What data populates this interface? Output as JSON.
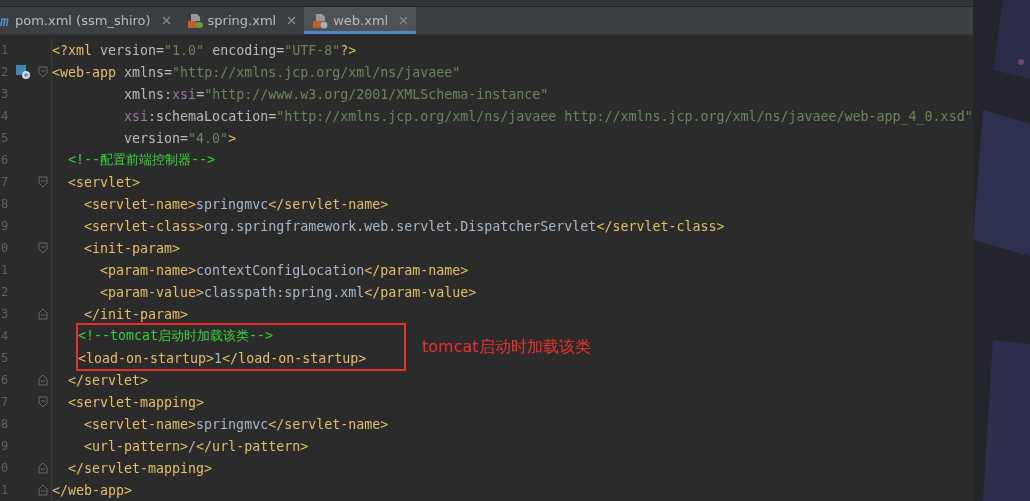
{
  "tabs": [
    {
      "label": "pom.xml (ssm_shiro)",
      "selected": false
    },
    {
      "label": "spring.xml",
      "selected": false
    },
    {
      "label": "web.xml",
      "selected": true
    }
  ],
  "editor": {
    "lines": [
      {
        "number": "1",
        "tokens": [
          {
            "kind": "tag",
            "text": "<?xml "
          },
          {
            "kind": "attr",
            "text": "version="
          },
          {
            "kind": "value",
            "text": "\"1.0\" "
          },
          {
            "kind": "attr",
            "text": "encoding="
          },
          {
            "kind": "value",
            "text": "\"UTF-8\""
          },
          {
            "kind": "tag",
            "text": "?>"
          }
        ]
      },
      {
        "number": "2",
        "marker": true,
        "fold_start": true,
        "tokens": [
          {
            "kind": "tag",
            "text": "<web-app "
          },
          {
            "kind": "attr",
            "text": "xmlns="
          },
          {
            "kind": "value",
            "text": "\"http://xmlns.jcp.org/xml/ns/javaee\""
          }
        ],
        "children": [
          {
            "number": "3",
            "continuation": true,
            "tokens": [
              {
                "kind": "attr",
                "text": "xmlns:"
              },
              {
                "kind": "ns",
                "text": "xsi"
              },
              {
                "kind": "attr",
                "text": "="
              },
              {
                "kind": "value",
                "text": "\"http://www.w3.org/2001/XMLSchema-instance\""
              }
            ]
          },
          {
            "number": "4",
            "continuation": true,
            "tokens": [
              {
                "kind": "ns",
                "text": "xsi"
              },
              {
                "kind": "attr",
                "text": ":schemaLocation="
              },
              {
                "kind": "value",
                "text": "\"http://xmlns.jcp.org/xml/ns/javaee http://xmlns.jcp.org/xml/ns/javaee/web-app_4_0.xsd\""
              }
            ]
          },
          {
            "number": "5",
            "continuation": true,
            "tokens": [
              {
                "kind": "attr",
                "text": "version="
              },
              {
                "kind": "value",
                "text": "\"4.0\""
              },
              {
                "kind": "tag",
                "text": ">"
              }
            ]
          },
          {
            "number": "6",
            "tokens": [
              {
                "kind": "comment",
                "text": "<!--配置前端控制器-->"
              }
            ]
          },
          {
            "number": "7",
            "fold_start": true,
            "tokens": [
              {
                "kind": "tag",
                "text": "<servlet>"
              }
            ],
            "children": [
              {
                "number": "8",
                "tokens": [
                  {
                    "kind": "tag",
                    "text": "<servlet-name>"
                  },
                  {
                    "kind": "text",
                    "text": "springmvc"
                  },
                  {
                    "kind": "tag",
                    "text": "</servlet-name>"
                  }
                ]
              },
              {
                "number": "9",
                "tokens": [
                  {
                    "kind": "tag",
                    "text": "<servlet-class>"
                  },
                  {
                    "kind": "text",
                    "text": "org.springframework.web.servlet.DispatcherServlet"
                  },
                  {
                    "kind": "tag",
                    "text": "</servlet-class>"
                  }
                ]
              },
              {
                "number": "0",
                "fold_start": true,
                "tokens": [
                  {
                    "kind": "tag",
                    "text": "<init-param>"
                  }
                ],
                "children": [
                  {
                    "number": "1",
                    "tokens": [
                      {
                        "kind": "tag",
                        "text": "<param-name>"
                      },
                      {
                        "kind": "text",
                        "text": "contextConfigLocation"
                      },
                      {
                        "kind": "tag",
                        "text": "</param-name>"
                      }
                    ]
                  },
                  {
                    "number": "2",
                    "tokens": [
                      {
                        "kind": "tag",
                        "text": "<param-value>"
                      },
                      {
                        "kind": "text",
                        "text": "classpath:spring.xml"
                      },
                      {
                        "kind": "tag",
                        "text": "</param-value>"
                      }
                    ]
                  }
                ]
              },
              {
                "number": "3",
                "fold_end": true,
                "tokens": [
                  {
                    "kind": "tag",
                    "text": "</init-param>"
                  }
                ]
              },
              {
                "number": "4",
                "boxed": true,
                "tokens": [
                  {
                    "kind": "comment",
                    "text": "<!--tomcat启动时加载该类-->"
                  }
                ]
              },
              {
                "number": "5",
                "boxed": true,
                "tokens": [
                  {
                    "kind": "tag",
                    "text": "<load-on-startup>"
                  },
                  {
                    "kind": "text",
                    "text": "1"
                  },
                  {
                    "kind": "tag",
                    "text": "</load-on-startup>"
                  }
                ]
              }
            ]
          },
          {
            "number": "6",
            "fold_end": true,
            "tokens": [
              {
                "kind": "tag",
                "text": "</servlet>"
              }
            ]
          },
          {
            "number": "7",
            "fold_start": true,
            "tokens": [
              {
                "kind": "tag",
                "text": "<servlet-mapping>"
              }
            ],
            "children": [
              {
                "number": "8",
                "tokens": [
                  {
                    "kind": "tag",
                    "text": "<servlet-name>"
                  },
                  {
                    "kind": "text",
                    "text": "springmvc"
                  },
                  {
                    "kind": "tag",
                    "text": "</servlet-name>"
                  }
                ]
              },
              {
                "number": "9",
                "tokens": [
                  {
                    "kind": "tag",
                    "text": "<url-pattern>"
                  },
                  {
                    "kind": "text",
                    "text": "/"
                  },
                  {
                    "kind": "tag",
                    "text": "</url-pattern>"
                  }
                ]
              }
            ]
          },
          {
            "number": "0",
            "fold_end": true,
            "tokens": [
              {
                "kind": "tag",
                "text": "</servlet-mapping>"
              }
            ]
          }
        ]
      },
      {
        "number": "1",
        "fold_end": true,
        "tokens": [
          {
            "kind": "tag",
            "text": "</web-app>"
          }
        ]
      }
    ],
    "annotation": "tomcat启动时加载该类"
  }
}
